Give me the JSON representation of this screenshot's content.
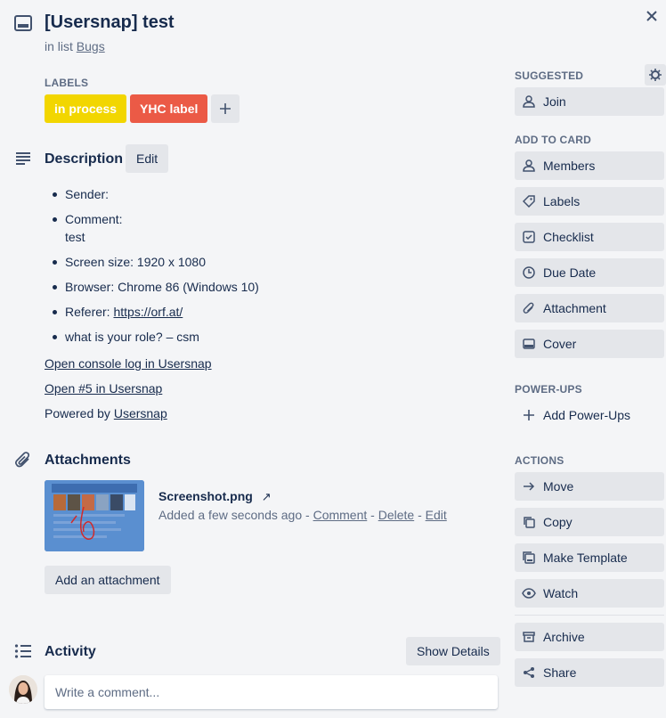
{
  "card": {
    "title": "[Usersnap] test",
    "in_list_prefix": "in list",
    "list_name": "Bugs"
  },
  "labels": {
    "heading": "LABELS",
    "items": [
      {
        "text": "in process",
        "color": "#f2d600"
      },
      {
        "text": "YHC label",
        "color": "#eb5a46"
      }
    ]
  },
  "description": {
    "heading": "Description",
    "edit_label": "Edit",
    "items": [
      {
        "label": "Sender:"
      },
      {
        "label": "Comment:",
        "value": "test"
      },
      {
        "label": "Screen size: 1920 x 1080"
      },
      {
        "label": "Browser: Chrome 86 (Windows 10)"
      },
      {
        "label": "Referer:",
        "link": "https://orf.at/"
      },
      {
        "label": "what is your role? – csm"
      }
    ],
    "console_link": "Open console log in Usersnap",
    "open_link": "Open #5 in Usersnap",
    "powered_prefix": "Powered by",
    "powered_link": "Usersnap"
  },
  "attachments": {
    "heading": "Attachments",
    "file_name": "Screenshot.png",
    "added_text": "Added a few seconds ago",
    "comment": "Comment",
    "delete": "Delete",
    "edit": "Edit",
    "sep": "-",
    "add_button": "Add an attachment"
  },
  "activity": {
    "heading": "Activity",
    "show_details": "Show Details",
    "comment_placeholder": "Write a comment..."
  },
  "sidebar": {
    "suggested_heading": "SUGGESTED",
    "join": "Join",
    "add_heading": "ADD TO CARD",
    "add_items": [
      "Members",
      "Labels",
      "Checklist",
      "Due Date",
      "Attachment",
      "Cover"
    ],
    "powerups_heading": "POWER-UPS",
    "add_powerups": "Add Power-Ups",
    "actions_heading": "ACTIONS",
    "actions": [
      "Move",
      "Copy",
      "Make Template",
      "Watch"
    ],
    "archive": "Archive",
    "share": "Share"
  }
}
